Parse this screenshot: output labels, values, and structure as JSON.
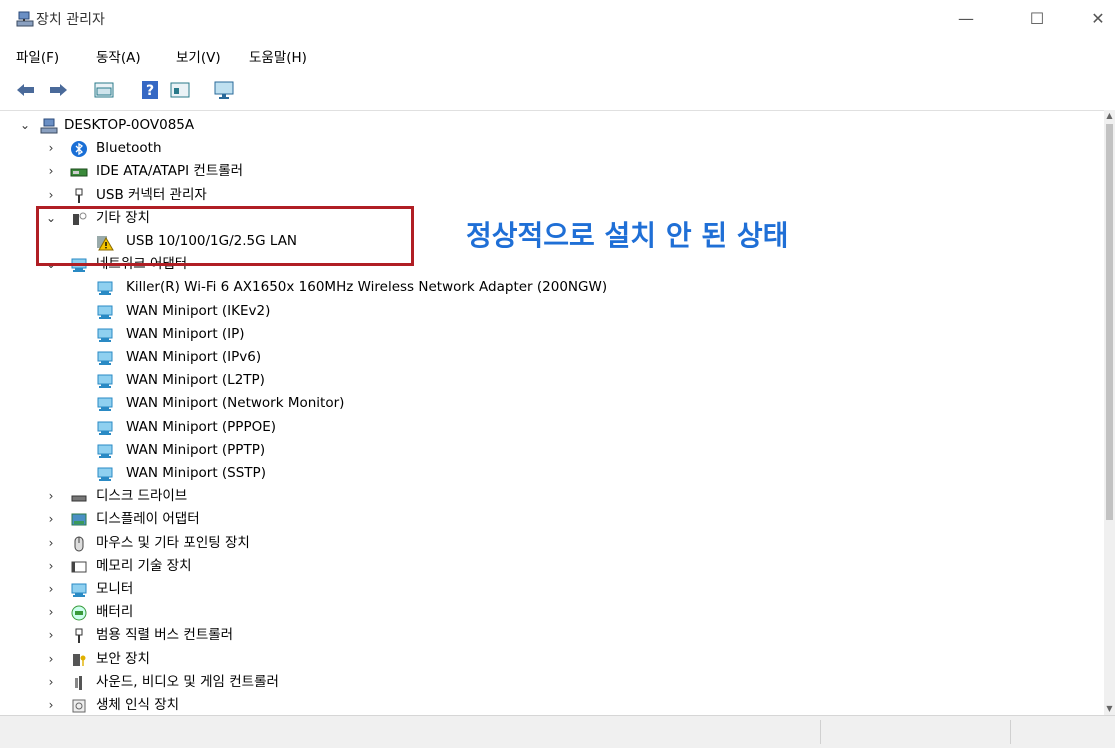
{
  "window": {
    "title": "장치 관리자",
    "minimize": "—",
    "maximize": "☐",
    "close": "✕"
  },
  "menu": [
    "파일(F)",
    "동작(A)",
    "보기(V)",
    "도움말(H)"
  ],
  "toolbar": {
    "buttons": [
      {
        "name": "back-icon",
        "glyph": "⇦"
      },
      {
        "name": "forward-icon",
        "glyph": "⇨"
      },
      {
        "name": "properties-icon",
        "glyph": "▦"
      },
      {
        "name": "help-icon",
        "glyph": "?"
      },
      {
        "name": "update-driver-icon",
        "glyph": "▤"
      },
      {
        "name": "monitor-icon",
        "glyph": "🖵"
      }
    ]
  },
  "tree": {
    "root": "DESKTOP-0OV085A",
    "items": [
      {
        "label": "Bluetooth",
        "icon": "bluetooth-icon",
        "expanded": false,
        "level": 1
      },
      {
        "label": "IDE ATA/ATAPI 컨트롤러",
        "icon": "ide-controller-icon",
        "expanded": false,
        "level": 1
      },
      {
        "label": "USB 커넥터 관리자",
        "icon": "usb-connector-icon",
        "expanded": false,
        "level": 1
      },
      {
        "label": "기타 장치",
        "icon": "other-devices-icon",
        "expanded": true,
        "level": 1
      },
      {
        "label": "USB 10/100/1G/2.5G LAN",
        "icon": "warning-device-icon",
        "level": 2
      },
      {
        "label": "네트워크 어댑터",
        "icon": "network-adapters-icon",
        "expanded": true,
        "level": 1
      },
      {
        "label": "Killer(R) Wi-Fi 6 AX1650x 160MHz Wireless Network Adapter (200NGW)",
        "icon": "network-adapter-icon",
        "level": 2
      },
      {
        "label": "WAN Miniport (IKEv2)",
        "icon": "network-adapter-icon",
        "level": 2
      },
      {
        "label": "WAN Miniport (IP)",
        "icon": "network-adapter-icon",
        "level": 2
      },
      {
        "label": "WAN Miniport (IPv6)",
        "icon": "network-adapter-icon",
        "level": 2
      },
      {
        "label": "WAN Miniport (L2TP)",
        "icon": "network-adapter-icon",
        "level": 2
      },
      {
        "label": "WAN Miniport (Network Monitor)",
        "icon": "network-adapter-icon",
        "level": 2
      },
      {
        "label": "WAN Miniport (PPPOE)",
        "icon": "network-adapter-icon",
        "level": 2
      },
      {
        "label": "WAN Miniport (PPTP)",
        "icon": "network-adapter-icon",
        "level": 2
      },
      {
        "label": "WAN Miniport (SSTP)",
        "icon": "network-adapter-icon",
        "level": 2
      },
      {
        "label": "디스크 드라이브",
        "icon": "disk-drive-icon",
        "expanded": false,
        "level": 1
      },
      {
        "label": "디스플레이 어댑터",
        "icon": "display-adapter-icon",
        "expanded": false,
        "level": 1
      },
      {
        "label": "마우스 및 기타 포인팅 장치",
        "icon": "mouse-icon",
        "expanded": false,
        "level": 1
      },
      {
        "label": "메모리 기술 장치",
        "icon": "memory-device-icon",
        "expanded": false,
        "level": 1
      },
      {
        "label": "모니터",
        "icon": "monitor-icon",
        "expanded": false,
        "level": 1
      },
      {
        "label": "배터리",
        "icon": "battery-icon",
        "expanded": false,
        "level": 1
      },
      {
        "label": "범용 직렬 버스 컨트롤러",
        "icon": "usb-controller-icon",
        "expanded": false,
        "level": 1
      },
      {
        "label": "보안 장치",
        "icon": "security-device-icon",
        "expanded": false,
        "level": 1
      },
      {
        "label": "사운드, 비디오 및 게임 컨트롤러",
        "icon": "sound-icon",
        "expanded": false,
        "level": 1
      },
      {
        "label": "생체 인식 장치",
        "icon": "biometric-icon",
        "expanded": false,
        "level": 1
      }
    ]
  },
  "annotation": {
    "text": "정상적으로 설치 안 된 상태",
    "color": "#1f6fd6",
    "box_color": "#b01e24"
  }
}
